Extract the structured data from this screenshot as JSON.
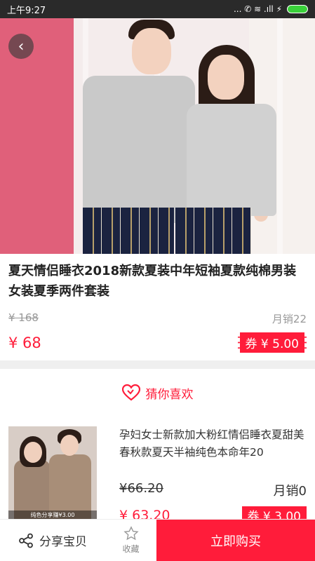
{
  "status_bar": {
    "time": "上午9:27",
    "icons": "... ✆ ≋ .ıll ⚡"
  },
  "hero": {
    "back_icon": "chevron-left-icon"
  },
  "product": {
    "title": "夏天情侣睡衣2018新款夏装中年短袖夏款纯棉男装女装夏季两件套装",
    "original_price": "¥ 168",
    "monthly_sales": "月销22",
    "current_price": "¥ 68",
    "coupon": "券 ¥ 5.00"
  },
  "guess": {
    "label": "猜你喜欢",
    "icon": "heart-icon"
  },
  "recommend": {
    "title": "孕妇女士新款加大粉红情侣睡衣夏甜美春秋款夏天半袖纯色本命年20",
    "original_price": "¥66.20",
    "monthly_sales": "月销0",
    "current_price": "¥ 63.20",
    "coupon": "券 ¥ 3.00",
    "image_caption": "纯色分享赚¥3.00"
  },
  "bottom_bar": {
    "share_label": "分享宝贝",
    "favorite_label": "收藏",
    "buy_label": "立即购买"
  },
  "colors": {
    "accent": "#ff1c3a",
    "divider": "#efefef"
  }
}
